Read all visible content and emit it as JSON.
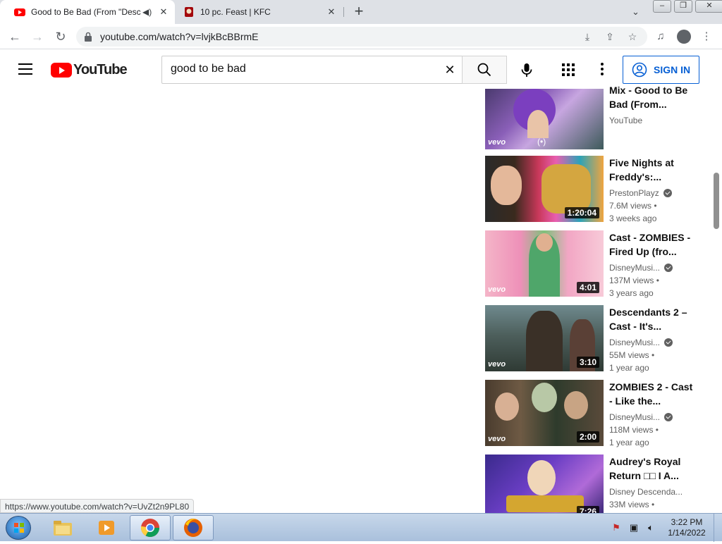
{
  "browser": {
    "tabs": [
      {
        "title": "Good to Be Bad (From \"Desc",
        "favicon": "youtube-icon",
        "muted_icon": "speaker-icon",
        "active": true
      },
      {
        "title": "10 pc. Feast | KFC",
        "favicon": "kfc-icon",
        "active": false
      }
    ],
    "new_tab": "+",
    "url": "youtube.com/watch?v=lvjkBcBBrmE",
    "status_url": "https://www.youtube.com/watch?v=UvZt2n9PL80"
  },
  "youtube": {
    "logo_text": "YouTube",
    "search_value": "good to be bad",
    "search_placeholder": "Search",
    "signin_label": "SIGN IN",
    "brand_color": "#ff0000",
    "accent_color": "#065fd4"
  },
  "recommendations": [
    {
      "title": "Mix - Good to Be Bad (From...",
      "channel": "YouTube",
      "verified": false,
      "views": "",
      "age": "",
      "duration": "",
      "badge": "vevo",
      "live_icon": "(•)"
    },
    {
      "title": "Five Nights at Freddy's:...",
      "channel": "PrestonPlayz",
      "verified": true,
      "views": "7.6M views",
      "age": "3 weeks ago",
      "duration": "1:20:04",
      "badge": ""
    },
    {
      "title": "Cast - ZOMBIES - Fired Up (fro...",
      "channel": "DisneyMusi...",
      "verified": true,
      "views": "137M views",
      "age": "3 years ago",
      "duration": "4:01",
      "badge": "vevo"
    },
    {
      "title": "Descendants 2 – Cast - It's...",
      "channel": "DisneyMusi...",
      "verified": true,
      "views": "55M views",
      "age": "1 year ago",
      "duration": "3:10",
      "badge": "vevo"
    },
    {
      "title": "ZOMBIES 2 - Cast - Like the...",
      "channel": "DisneyMusi...",
      "verified": true,
      "views": "118M views",
      "age": "1 year ago",
      "duration": "2:00",
      "badge": "vevo"
    },
    {
      "title": "Audrey's Royal Return □□ I A...",
      "channel": "Disney Descenda...",
      "verified": false,
      "views": "33M views",
      "age": "",
      "duration": "7:26",
      "badge": ""
    }
  ],
  "taskbar": {
    "time": "3:22 PM",
    "date": "1/14/2022"
  }
}
